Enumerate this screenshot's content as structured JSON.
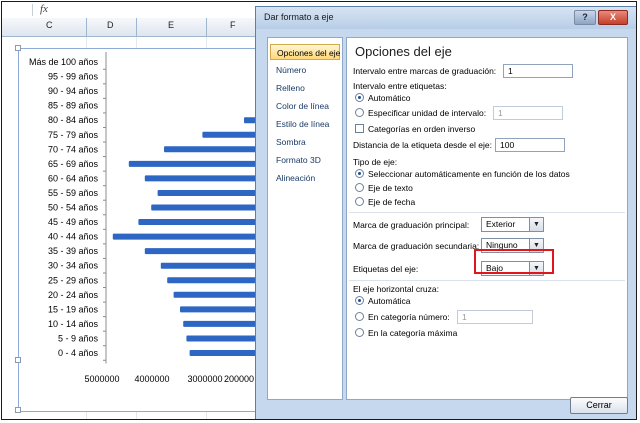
{
  "excel": {
    "formula_icon": "fx-icon",
    "columns": [
      "C",
      "D",
      "E",
      "F"
    ]
  },
  "chart_data": {
    "type": "bar",
    "orientation": "horizontal",
    "x_reversed": true,
    "categories": [
      "Más de 100 años",
      "95 - 99 años",
      "90 - 94 años",
      "85 - 89 años",
      "80 - 84 años",
      "75 - 79 años",
      "70 - 74 años",
      "65 - 69 años",
      "60 - 64 años",
      "55 - 59 años",
      "50 - 54 años",
      "45 - 49 años",
      "40 - 44 años",
      "35 - 39 años",
      "30 - 34 años",
      "25 - 29 años",
      "20 - 24 años",
      "15 - 19 años",
      "10 - 14 años",
      "5 - 9 años",
      "0 - 4 años"
    ],
    "values": [
      0,
      0,
      0,
      0,
      500000,
      1800000,
      3000000,
      4100000,
      3600000,
      3200000,
      3400000,
      3800000,
      4600000,
      3600000,
      3100000,
      2900000,
      2700000,
      2500000,
      2400000,
      2300000,
      2200000
    ],
    "xlim": [
      0,
      5000000
    ],
    "x_ticks": [
      "5000000",
      "4000000",
      "3000000",
      "200000"
    ],
    "bar_color": "#2e66c4"
  },
  "dialog": {
    "title": "Dar formato a eje",
    "help_label": "?",
    "close_label": "X",
    "nav_items": [
      "Opciones del eje",
      "Número",
      "Relleno",
      "Color de línea",
      "Estilo de línea",
      "Sombra",
      "Formato 3D",
      "Alineación"
    ],
    "panel_title": "Opciones del eje",
    "intervalo_marcas": {
      "label": "Intervalo entre marcas de graduación:",
      "value": "1"
    },
    "intervalo_etiquetas": {
      "label": "Intervalo entre etiquetas:"
    },
    "radio_automatico": "Automático",
    "radio_especificar": {
      "label": "Especificar unidad de intervalo:",
      "value": "1"
    },
    "check_orden_inverso": "Categorías en orden inverso",
    "distancia": {
      "label": "Distancia de la etiqueta desde el eje:",
      "value": "100"
    },
    "tipo_eje": {
      "label": "Tipo de eje:",
      "options": [
        "Seleccionar automáticamente en función de los datos",
        "Eje de texto",
        "Eje de fecha"
      ]
    },
    "marca_principal": {
      "label": "Marca de graduación principal:",
      "value": "Exterior"
    },
    "marca_secundaria": {
      "label": "Marca de graduación secundaria:",
      "value": "Ninguno"
    },
    "etiquetas_eje": {
      "label": "Etiquetas del eje:",
      "value": "Bajo"
    },
    "eje_horizontal": {
      "label": "El eje horizontal cruza:",
      "automatica": "Automática",
      "categoria_numero": {
        "label": "En categoría número:",
        "value": "1"
      },
      "categoria_maxima": "En la categoría máxima"
    },
    "cerrar_label": "Cerrar",
    "highlight_color": "#e0161b"
  }
}
